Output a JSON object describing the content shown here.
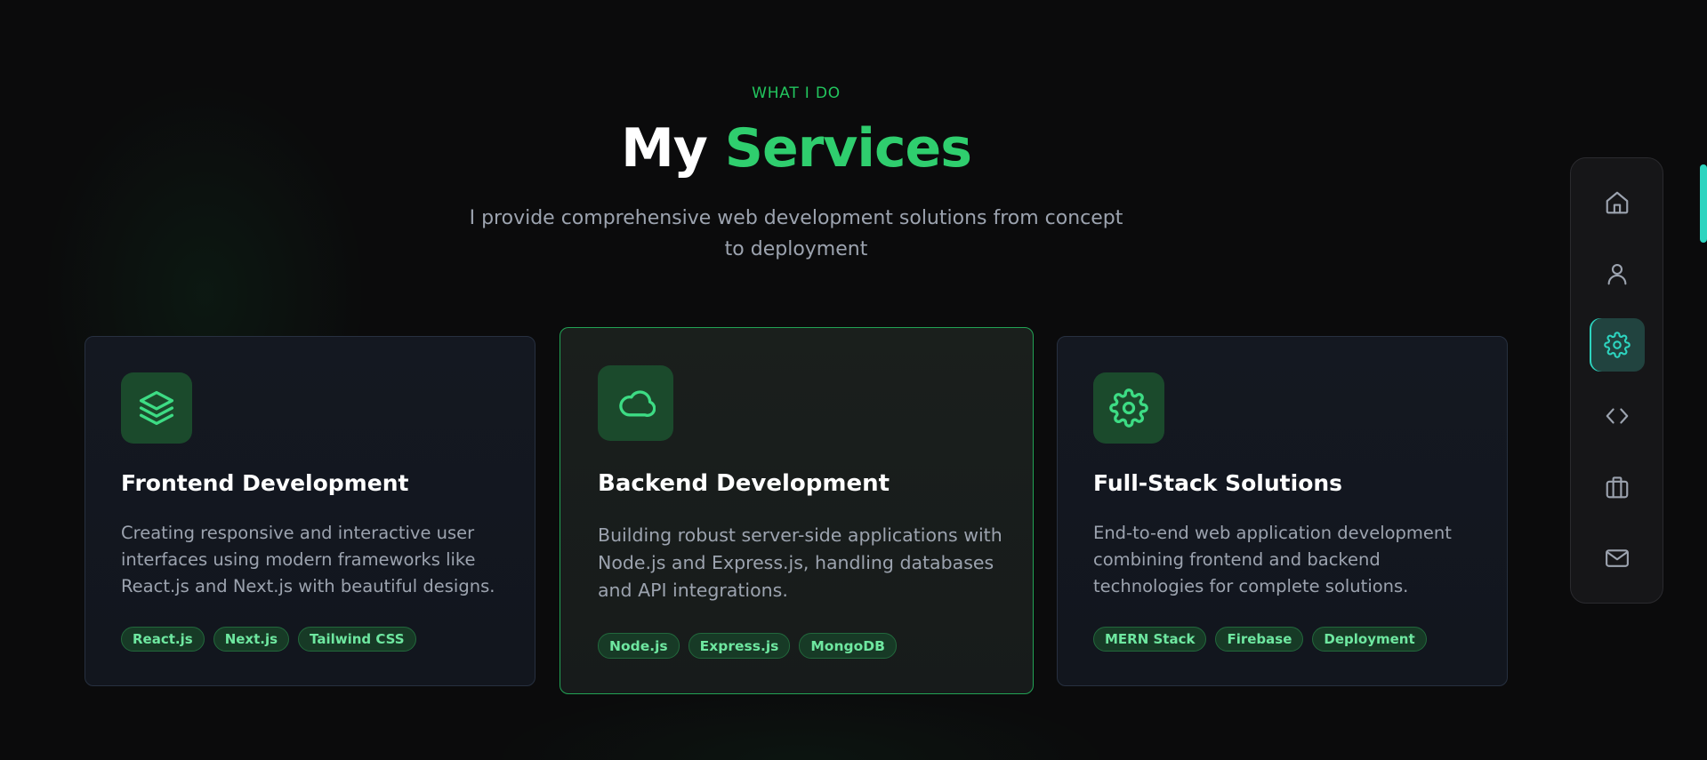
{
  "header": {
    "eyebrow": "WHAT I DO",
    "title_plain": "My",
    "title_accent": "Services",
    "subtitle": "I provide comprehensive web development solutions from concept to deployment"
  },
  "services": [
    {
      "icon": "layers-icon",
      "title": "Frontend Development",
      "description": "Creating responsive and interactive user interfaces using modern frameworks like React.js and Next.js with beautiful designs.",
      "tags": [
        "React.js",
        "Next.js",
        "Tailwind CSS"
      ]
    },
    {
      "icon": "cloud-icon",
      "title": "Backend Development",
      "description": "Building robust server-side applications with Node.js and Express.js, handling databases and API integrations.",
      "tags": [
        "Node.js",
        "Express.js",
        "MongoDB"
      ]
    },
    {
      "icon": "gear-icon",
      "title": "Full-Stack Solutions",
      "description": "End-to-end web application development combining frontend and backend technologies for complete solutions.",
      "tags": [
        "MERN Stack",
        "Firebase",
        "Deployment"
      ]
    }
  ],
  "side_nav": {
    "items": [
      {
        "icon": "home-icon",
        "active": false
      },
      {
        "icon": "user-icon",
        "active": false
      },
      {
        "icon": "gear-icon",
        "active": true
      },
      {
        "icon": "code-icon",
        "active": false
      },
      {
        "icon": "briefcase-icon",
        "active": false
      },
      {
        "icon": "mail-icon",
        "active": false
      }
    ]
  },
  "colors": {
    "accent": "#22c55e",
    "nav_active": "#2dd4bf",
    "background": "#0b0b0c",
    "card": "#141821"
  }
}
